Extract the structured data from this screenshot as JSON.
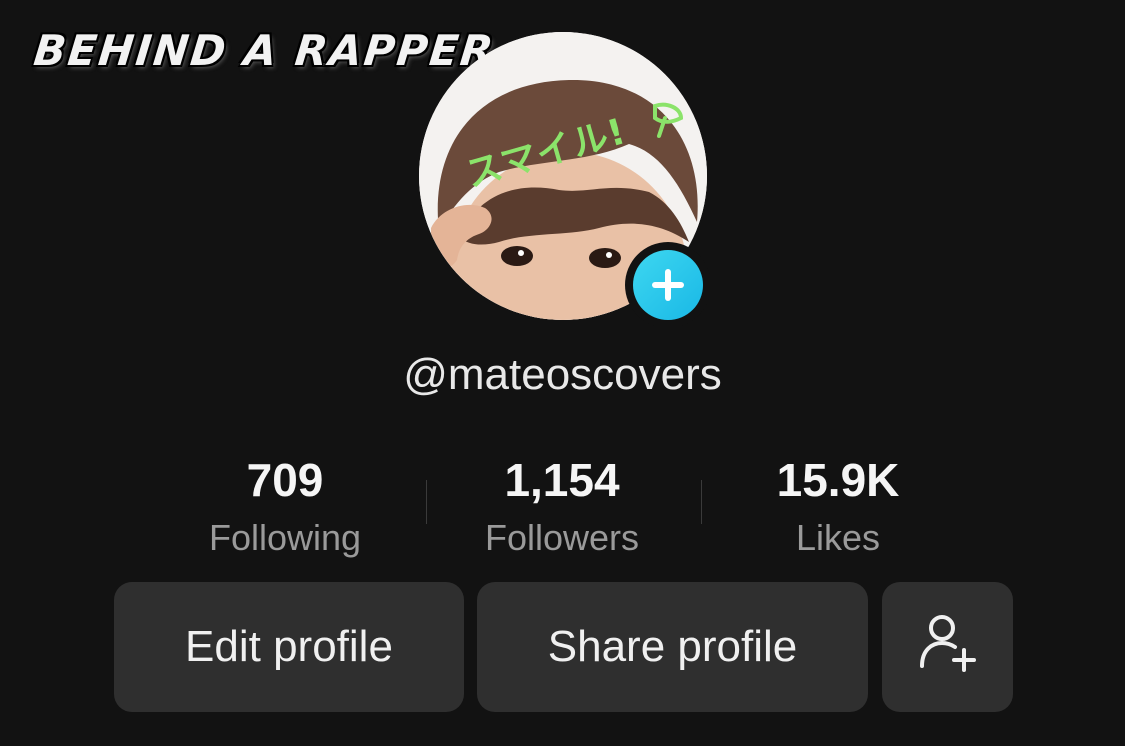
{
  "overlay": {
    "title": "BEHIND A RAPPER .."
  },
  "avatar": {
    "sticker_text": "スマイル!",
    "badge_icon": "plus-icon",
    "badge_color": "#20c5ea"
  },
  "profile": {
    "username": "@mateoscovers"
  },
  "stats": [
    {
      "value": "709",
      "label": "Following"
    },
    {
      "value": "1,154",
      "label": "Followers"
    },
    {
      "value": "15.9K",
      "label": "Likes"
    }
  ],
  "actions": {
    "edit_label": "Edit profile",
    "share_label": "Share profile",
    "add_friend_icon": "add-user-icon"
  },
  "colors": {
    "background": "#121212",
    "button": "#2f2f2f",
    "muted_text": "#9a9a9a"
  }
}
